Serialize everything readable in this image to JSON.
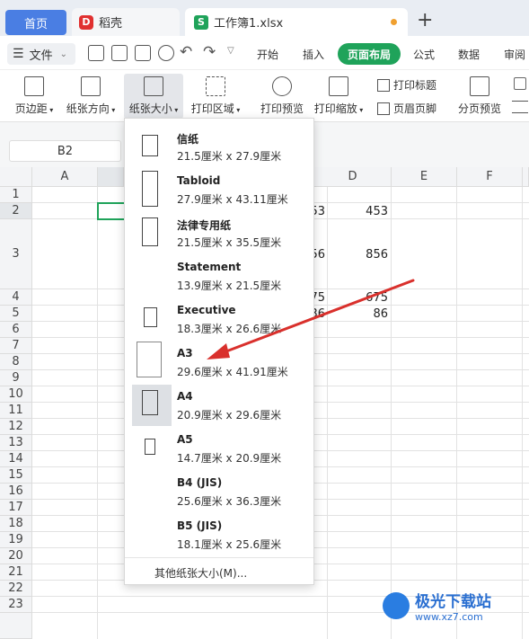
{
  "tabs": {
    "home": "首页",
    "daoke": "稻壳",
    "workbook": "工作簿1.xlsx",
    "daoke_icon": "D",
    "workbook_icon": "S",
    "new_tab": "+"
  },
  "menubar": {
    "file_label": "文件",
    "items": [
      "开始",
      "插入",
      "页面布局",
      "公式",
      "数据",
      "审阅"
    ],
    "active": "页面布局"
  },
  "ribbon": {
    "margin": "页边距",
    "orientation": "纸张方向",
    "size": "纸张大小",
    "print_area": "打印区域",
    "print_preview": "打印预览",
    "print_scale": "打印缩放",
    "print_titles": "打印标题",
    "header_footer": "页眉页脚",
    "page_break_preview": "分页预览"
  },
  "namebox": "B2",
  "grid": {
    "columns": [
      "A",
      "",
      "",
      "D",
      "E",
      "F"
    ],
    "rows": [
      "1",
      "2",
      "3",
      "4",
      "5",
      "6",
      "7",
      "8",
      "9",
      "10",
      "11",
      "12",
      "13",
      "14",
      "15",
      "16",
      "17",
      "18",
      "19",
      "20",
      "21",
      "22",
      "23"
    ],
    "values": {
      "c2_partial": "53",
      "d2": "453",
      "c3_partial": "56",
      "d3": "856",
      "c4_partial": "75",
      "d4": "675",
      "c5_partial": "36",
      "d5": "86"
    }
  },
  "paper_sizes": [
    {
      "name": "信纸",
      "dims": "21.5厘米  x  27.9厘米"
    },
    {
      "name": "Tabloid",
      "dims": "27.9厘米  x  43.11厘米"
    },
    {
      "name": "法律专用纸",
      "dims": "21.5厘米  x  35.5厘米"
    },
    {
      "name": "Statement",
      "dims": "13.9厘米  x  21.5厘米"
    },
    {
      "name": "Executive",
      "dims": "18.3厘米  x  26.6厘米"
    },
    {
      "name": "A3",
      "dims": "29.6厘米  x  41.91厘米"
    },
    {
      "name": "A4",
      "dims": "20.9厘米  x  29.6厘米"
    },
    {
      "name": "A5",
      "dims": "14.7厘米  x  20.9厘米"
    },
    {
      "name": "B4 (JIS)",
      "dims": "25.6厘米  x  36.3厘米"
    },
    {
      "name": "B5 (JIS)",
      "dims": "18.1厘米  x  25.6厘米"
    }
  ],
  "selected_paper": "A4",
  "more_sizes": "其他纸张大小(M)...",
  "watermark": {
    "title": "极光下载站",
    "url": "www.xz7.com"
  },
  "colors": {
    "accent_green": "#1fa35a",
    "home_tab": "#4a7ee3",
    "annotation_arrow": "#d9302c"
  }
}
